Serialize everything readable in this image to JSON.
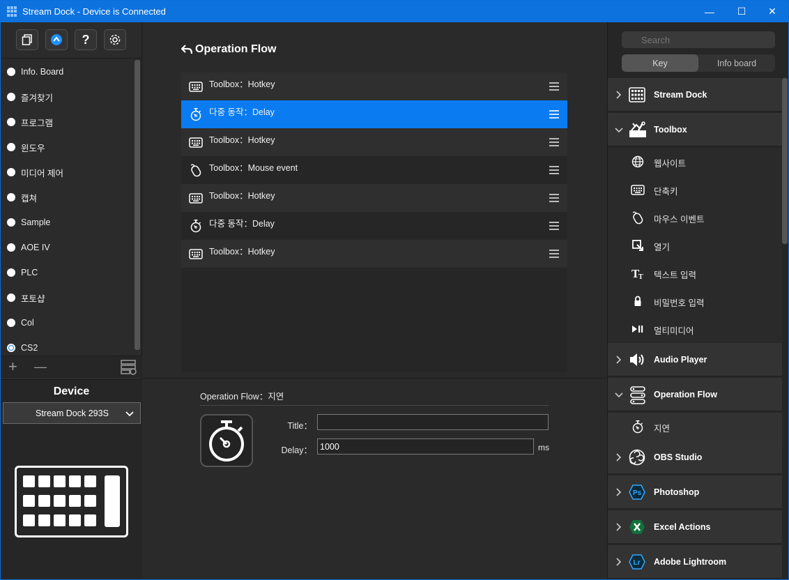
{
  "window": {
    "title": "Stream Dock - Device is Connected",
    "minimize_glyph": "—",
    "maximize_glyph": "☐",
    "close_glyph": "✕"
  },
  "left": {
    "toolbar_icons": [
      "pages-icon",
      "store-icon",
      "help-icon",
      "settings-icon"
    ],
    "help_glyph": "?",
    "profiles": [
      {
        "label": "Info. Board",
        "selected": false
      },
      {
        "label": "즐겨찾기",
        "selected": false
      },
      {
        "label": "프로그램",
        "selected": false
      },
      {
        "label": "윈도우",
        "selected": false
      },
      {
        "label": "미디어 제어",
        "selected": false
      },
      {
        "label": "캡쳐",
        "selected": false
      },
      {
        "label": "Sample",
        "selected": false
      },
      {
        "label": "AOE IV",
        "selected": false
      },
      {
        "label": "PLC",
        "selected": false
      },
      {
        "label": "포토샵",
        "selected": false
      },
      {
        "label": "Col",
        "selected": false
      },
      {
        "label": "CS2",
        "selected": true
      }
    ],
    "add_glyph": "+",
    "remove_glyph": "—",
    "device_title": "Device",
    "device_select": "Stream Dock 293S"
  },
  "center": {
    "title": "Operation Flow",
    "flow": [
      {
        "label": "Toolbox：Hotkey",
        "icon": "keyboard-icon",
        "selected": false
      },
      {
        "label": "다중 동작：Delay",
        "icon": "stopwatch-icon",
        "selected": true
      },
      {
        "label": "Toolbox：Hotkey",
        "icon": "keyboard-icon",
        "selected": false
      },
      {
        "label": "Toolbox：Mouse event",
        "icon": "mouse-icon",
        "selected": false
      },
      {
        "label": "Toolbox：Hotkey",
        "icon": "keyboard-icon",
        "selected": false
      },
      {
        "label": "다중 동작：Delay",
        "icon": "stopwatch-icon",
        "selected": false
      },
      {
        "label": "Toolbox：Hotkey",
        "icon": "keyboard-icon",
        "selected": false
      }
    ],
    "detail": {
      "title": "Operation Flow：지연",
      "title_label": "Title：",
      "title_value": "",
      "delay_label": "Delay：",
      "delay_value": "1000",
      "delay_unit": "ms"
    }
  },
  "right": {
    "search_placeholder": "Search",
    "tabs": [
      "Key",
      "Info board"
    ],
    "active_tab": 0,
    "categories": [
      {
        "label": "Stream Dock",
        "expanded": false,
        "icon": "keypad-icon"
      },
      {
        "label": "Toolbox",
        "expanded": true,
        "icon": "toolbox-icon",
        "items": [
          {
            "label": "웹사이트",
            "icon": "globe-icon"
          },
          {
            "label": "단축키",
            "icon": "keyboard-icon"
          },
          {
            "label": "마우스 이벤트",
            "icon": "mouse-icon"
          },
          {
            "label": "열기",
            "icon": "open-icon"
          },
          {
            "label": "텍스트 입력",
            "icon": "text-icon"
          },
          {
            "label": "비밀번호 입력",
            "icon": "lock-icon"
          },
          {
            "label": "멀티미디어",
            "icon": "play-pause-icon"
          }
        ]
      },
      {
        "label": "Audio Player",
        "expanded": false,
        "icon": "speaker-icon"
      },
      {
        "label": "Operation Flow",
        "expanded": true,
        "icon": "flow-icon",
        "items": [
          {
            "label": "지연",
            "icon": "stopwatch-icon"
          }
        ]
      },
      {
        "label": "OBS Studio",
        "expanded": false,
        "icon": "obs-icon"
      },
      {
        "label": "Photoshop",
        "expanded": false,
        "icon": "photoshop-icon"
      },
      {
        "label": "Excel Actions",
        "expanded": false,
        "icon": "excel-icon"
      },
      {
        "label": "Adobe Lightroom",
        "expanded": false,
        "icon": "lightroom-icon"
      }
    ],
    "ps_mark": "Ps",
    "lr_mark": "Lr",
    "text_mark": "T"
  },
  "colors": {
    "accent": "#0a7bf0",
    "titlebar": "#0d72dd"
  }
}
